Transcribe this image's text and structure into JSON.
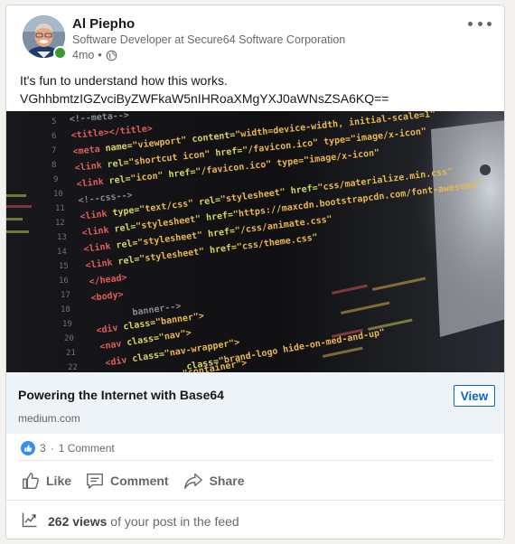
{
  "author": {
    "name": "Al Piepho",
    "headline": "Software Developer at Secure64 Software Corporation",
    "time_ago": "4mo",
    "separator": "•"
  },
  "post": {
    "text_line1": "It's fun to understand how this works.",
    "text_line2": "VGhhbmtzIGZvciByZWFkaW5nIHRoaXMgYXJ0aWNsZSA6KQ=="
  },
  "link_preview": {
    "title": "Powering the Internet with Base64",
    "domain": "medium.com",
    "view_label": "View"
  },
  "social": {
    "reaction_count": "3",
    "separator": "·",
    "comments": "1 Comment"
  },
  "actions": {
    "like": "Like",
    "comment": "Comment",
    "share": "Share"
  },
  "analytics": {
    "views": "262 views",
    "suffix": "of your post in the feed"
  },
  "colors": {
    "accent": "#0a66c2",
    "presence": "#3a9b2f",
    "preview_bg": "#eef3f8"
  }
}
